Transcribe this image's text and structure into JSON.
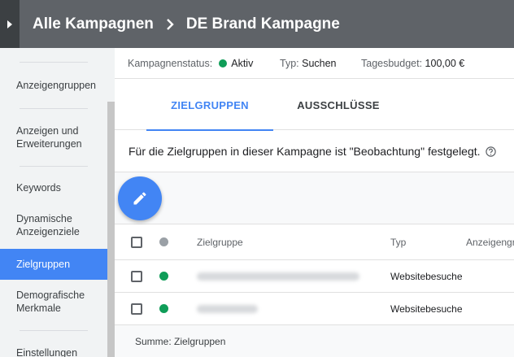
{
  "header": {
    "breadcrumb_root": "Alle Kampagnen",
    "breadcrumb_current": "DE Brand Kampagne"
  },
  "sidebar": {
    "items": [
      {
        "label": "Anzeigengruppen"
      },
      {
        "label": "Anzeigen und Erweiterungen"
      },
      {
        "label": "Keywords"
      },
      {
        "label": "Dynamische Anzeigenziele"
      },
      {
        "label": "Zielgruppen",
        "active": true
      },
      {
        "label": "Demografische Merkmale"
      },
      {
        "label": "Einstellungen"
      }
    ]
  },
  "status": {
    "campaign_status_label": "Kampagnenstatus:",
    "campaign_status_value": "Aktiv",
    "type_label": "Typ:",
    "type_value": "Suchen",
    "budget_label": "Tagesbudget:",
    "budget_value": "100,00 €"
  },
  "tabs": [
    {
      "label": "ZIELGRUPPEN",
      "active": true
    },
    {
      "label": "AUSSCHLÜSSE",
      "active": false
    }
  ],
  "info_text": "Für die Zielgruppen in dieser Kampagne ist \"Beobachtung\" festgelegt.",
  "table": {
    "columns": {
      "name": "Zielgruppe",
      "type": "Typ",
      "group": "Anzeigengr"
    },
    "rows": [
      {
        "type": "Websitebesuche",
        "status_color": "#0f9d58"
      },
      {
        "type": "Websitebesuche",
        "status_color": "#0f9d58"
      }
    ]
  },
  "summary": "Summe: Zielgruppen",
  "colors": {
    "accent": "#4285f4",
    "active_green": "#0f9d58",
    "header_bg": "#5f6368"
  },
  "icons": {
    "sidebar_toggle": "triangle-right-icon",
    "breadcrumb_separator": "chevron-right-icon",
    "help": "help-circle-icon",
    "edit": "pencil-icon"
  }
}
